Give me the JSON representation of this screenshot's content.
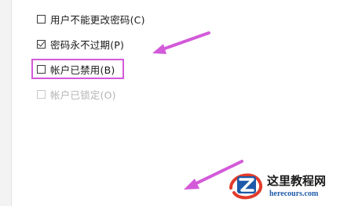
{
  "options": [
    {
      "label": "用户不能更改密码(C)",
      "checked": false,
      "enabled": true
    },
    {
      "label": "密码永不过期(P)",
      "checked": true,
      "enabled": true
    },
    {
      "label": "帐户已禁用(B)",
      "checked": false,
      "enabled": true
    },
    {
      "label": "帐户已锁定(O)",
      "checked": false,
      "enabled": false
    }
  ],
  "watermark": {
    "name": "这里教程网",
    "url": "herecours.com"
  },
  "colors": {
    "annotation": "#d35ad9",
    "watermark_blue": "#1e5aa8",
    "watermark_red": "#e23a2a"
  }
}
